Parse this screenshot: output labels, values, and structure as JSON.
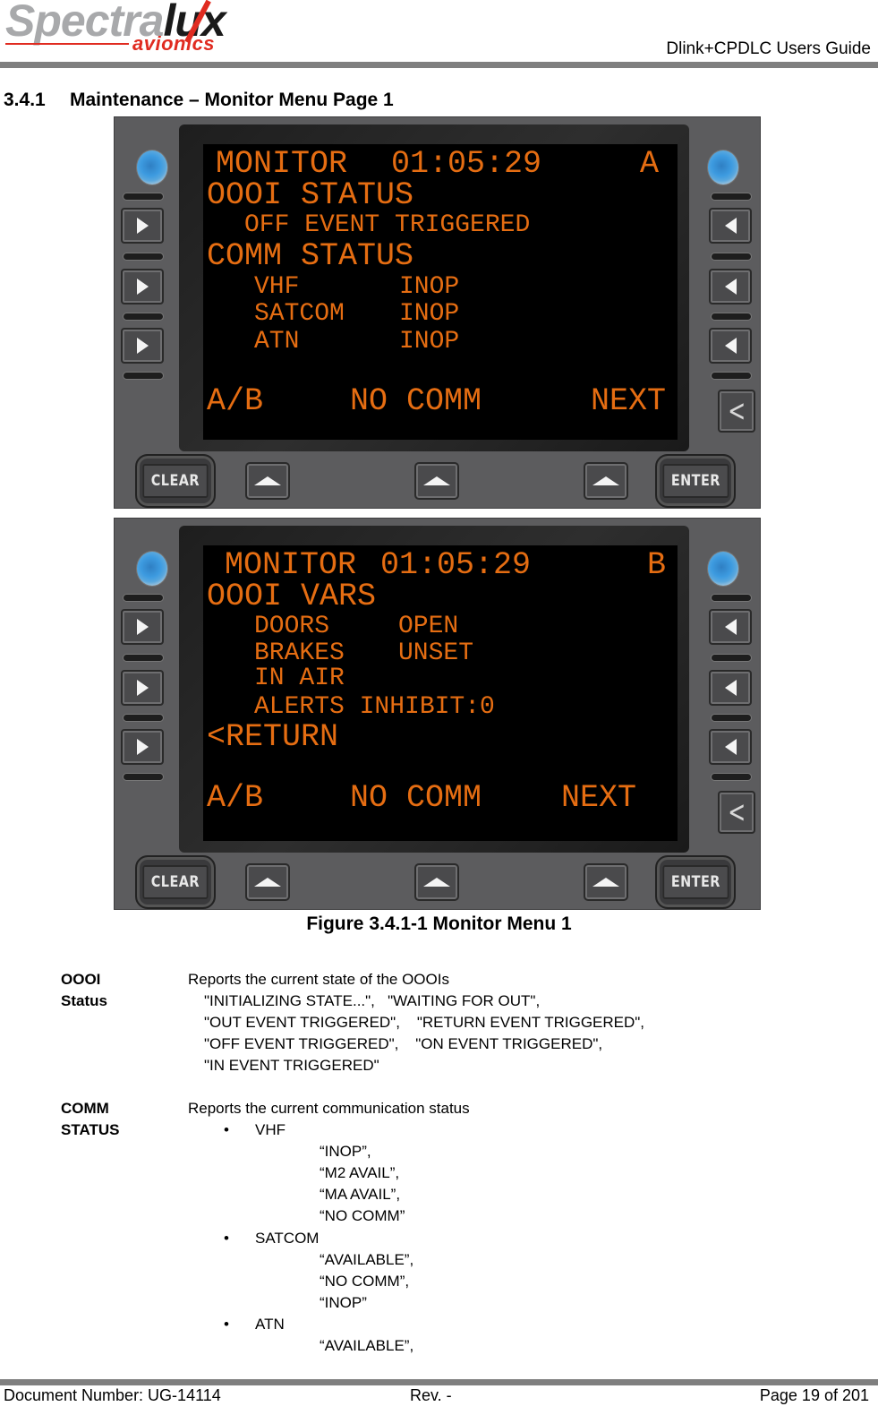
{
  "header": {
    "logo_brand_light": "Spectra",
    "logo_brand_dark": "lux",
    "logo_sub": "avionics",
    "doc_title": "Dlink+CPDLC Users Guide"
  },
  "section": {
    "number": "3.4.1",
    "title": "Maintenance – Monitor Menu Page 1"
  },
  "cdu_buttons": {
    "clear": "CLEAR",
    "enter": "ENTER"
  },
  "screen_a": {
    "title": "MONITOR",
    "time": "01:05:29",
    "page": "A",
    "oooi_header": "OOOI STATUS",
    "oooi_value": "OFF EVENT TRIGGERED",
    "comm_header": "COMM STATUS",
    "rows": [
      {
        "label": "VHF",
        "value": "INOP"
      },
      {
        "label": "SATCOM",
        "value": "INOP"
      },
      {
        "label": "ATN",
        "value": "INOP"
      }
    ],
    "soft_left": "A/B",
    "soft_center": "NO COMM",
    "soft_right": "NEXT"
  },
  "screen_b": {
    "title": "MONITOR",
    "time": "01:05:29",
    "page": "B",
    "vars_header": "OOOI VARS",
    "rows": [
      {
        "label": "DOORS",
        "value": "OPEN"
      },
      {
        "label": "BRAKES",
        "value": "UNSET"
      },
      {
        "label": "IN AIR",
        "value": ""
      }
    ],
    "alerts": "ALERTS INHIBIT:0",
    "return": "<RETURN",
    "soft_left": "A/B",
    "soft_center": "NO COMM",
    "soft_right": "NEXT"
  },
  "figure_caption": "Figure 3.4.1-1 Monitor Menu 1",
  "definitions": {
    "oooi": {
      "term_line1": "OOOI",
      "term_line2": "Status",
      "description": "Reports the current state of the OOOIs",
      "values": [
        "\"INITIALIZING STATE...\",   \"WAITING FOR OUT\",",
        "\"OUT EVENT TRIGGERED\",    \"RETURN EVENT TRIGGERED\",",
        "\"OFF EVENT TRIGGERED\",    \"ON EVENT TRIGGERED\",",
        "\"IN EVENT TRIGGERED\""
      ]
    },
    "comm": {
      "term_line1": "COMM",
      "term_line2": "STATUS",
      "description": "Reports the current communication status",
      "bullets": [
        {
          "name": "VHF",
          "values": [
            "“INOP”,",
            "“M2 AVAIL”,",
            "“MA AVAIL”,",
            "“NO COMM”"
          ]
        },
        {
          "name": "SATCOM",
          "values": [
            "“AVAILABLE”,",
            "“NO COMM”,",
            "“INOP”"
          ]
        },
        {
          "name": "ATN",
          "values": [
            "“AVAILABLE”,"
          ]
        }
      ],
      "bullet_glyph": "•"
    }
  },
  "footer": {
    "doc_number": "Document Number:  UG-14114",
    "revision": "Rev. -",
    "page": "Page 19 of 201"
  }
}
